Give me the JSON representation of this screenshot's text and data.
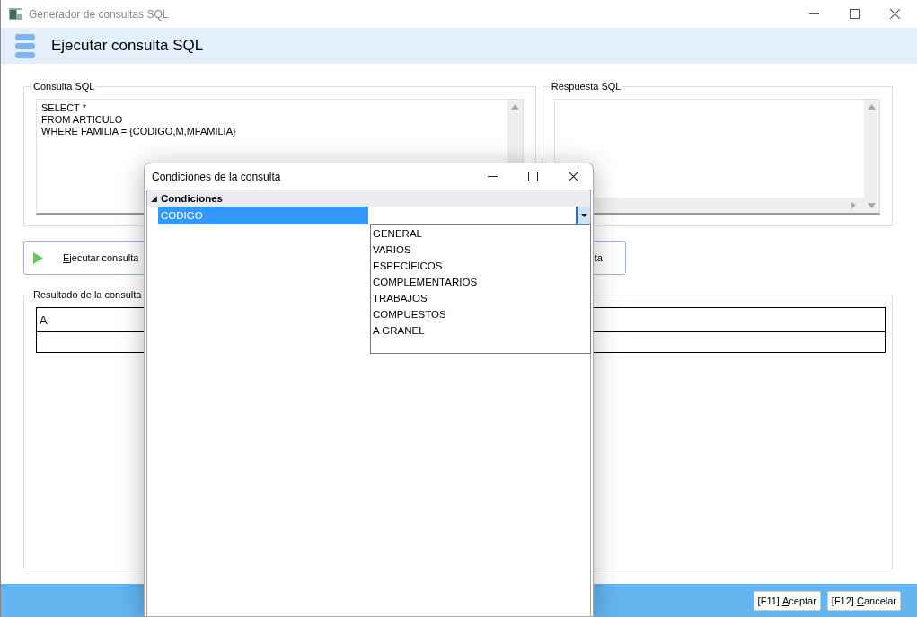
{
  "window": {
    "title": "Generador de consultas SQL"
  },
  "header": {
    "title": "Ejecutar consulta SQL"
  },
  "sql_query": {
    "label": "Consulta SQL",
    "lines": [
      "SELECT *",
      "FROM ARTICULO",
      "WHERE FAMILIA = {CODIGO,M,MFAMILIA}"
    ]
  },
  "sql_response": {
    "label": "Respuesta SQL"
  },
  "actions": [
    {
      "kind": "run",
      "label": "Ejecutar consulta"
    },
    {
      "kind": "plain",
      "label": "ta"
    }
  ],
  "result": {
    "label": "Resultado de la consulta",
    "columns": [
      "A"
    ]
  },
  "footer_buttons": [
    {
      "key": "[F11]",
      "label": "Aceptar"
    },
    {
      "key": "[F12]",
      "label": "Cancelar"
    }
  ],
  "dialog": {
    "title": "Condiciones de la consulta",
    "category": {
      "label": "Condiciones",
      "expanded": true
    },
    "rows": [
      {
        "name": "CODIGO",
        "selected": true
      }
    ],
    "dropdown": {
      "open": true,
      "options": [
        {
          "label": "GENERAL",
          "selected": false
        },
        {
          "label": "VARIOS",
          "selected": false
        },
        {
          "label": "ESPECÍFICOS",
          "selected": false
        },
        {
          "label": "COMPLEMENTARIOS",
          "selected": false
        },
        {
          "label": "TRABAJOS",
          "selected": false
        },
        {
          "label": "COMPUESTOS",
          "selected": false
        },
        {
          "label": "A GRANEL",
          "selected": false
        }
      ]
    }
  }
}
